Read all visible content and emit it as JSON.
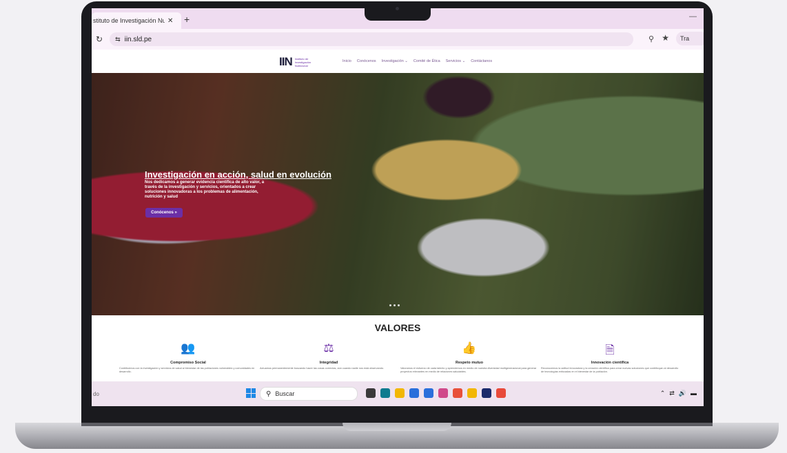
{
  "browser": {
    "tab_title": "stituto de Investigación Nutri",
    "tab_close": "✕",
    "new_tab": "+",
    "url": "iin.sld.pe",
    "translate_label": "Tra"
  },
  "site": {
    "logo_mark": "IIN",
    "logo_text": "Instituto de Investigación Nutricional",
    "nav": [
      "Inicio",
      "Conócenos",
      "Investigación ⌄",
      "Comité de Ética",
      "Servicios ⌄",
      "Contáctanos"
    ]
  },
  "hero": {
    "title": "Investigación en acción, salud en evolución",
    "text": "Nos dedicamos a generar evidencia científica de alto valor, a través de la investigación y servicios, orientados a crear soluciones innovadoras a los problemas de alimentación, nutrición y salud",
    "button": "Conócenos »"
  },
  "valores": {
    "title": "VALORES",
    "items": [
      {
        "icon": "people-icon",
        "title": "Compromiso Social",
        "text": "Contribuimos con la investigación y servicios de salud al bienestar de las poblaciones vulnerables y comunidades en desarrollo."
      },
      {
        "icon": "balance-icon",
        "title": "Integridad",
        "text": "Actuamos permanentemente buscando hacer las cosas correctas, aún cuando nadie nos está observando."
      },
      {
        "icon": "thumbs-up-icon",
        "title": "Respeto mutuo",
        "text": "Valoramos el esfuerzo de cada talento y aprendemos en medio de nuestra diversidad multigeneracional para generar proyectos relevantes en medio de relaciones saludables."
      },
      {
        "icon": "document-search-icon",
        "title": "Innovación científica",
        "text": "Reconocemos la actitud innovadora y la creación científica para crear nuevas soluciones que contribuyan al desarrollo de tecnologías enfocadas en el bienestar de la población."
      }
    ]
  },
  "taskbar": {
    "left_text": "do",
    "search_placeholder": "Buscar",
    "app_colors": [
      "#3a3a3a",
      "#0f7b8f",
      "#f2b705",
      "#2a6fdb",
      "#2a6fdb",
      "#d04a8b",
      "#e8503a",
      "#f2b705",
      "#1b2a6b",
      "#e84a3a"
    ]
  }
}
